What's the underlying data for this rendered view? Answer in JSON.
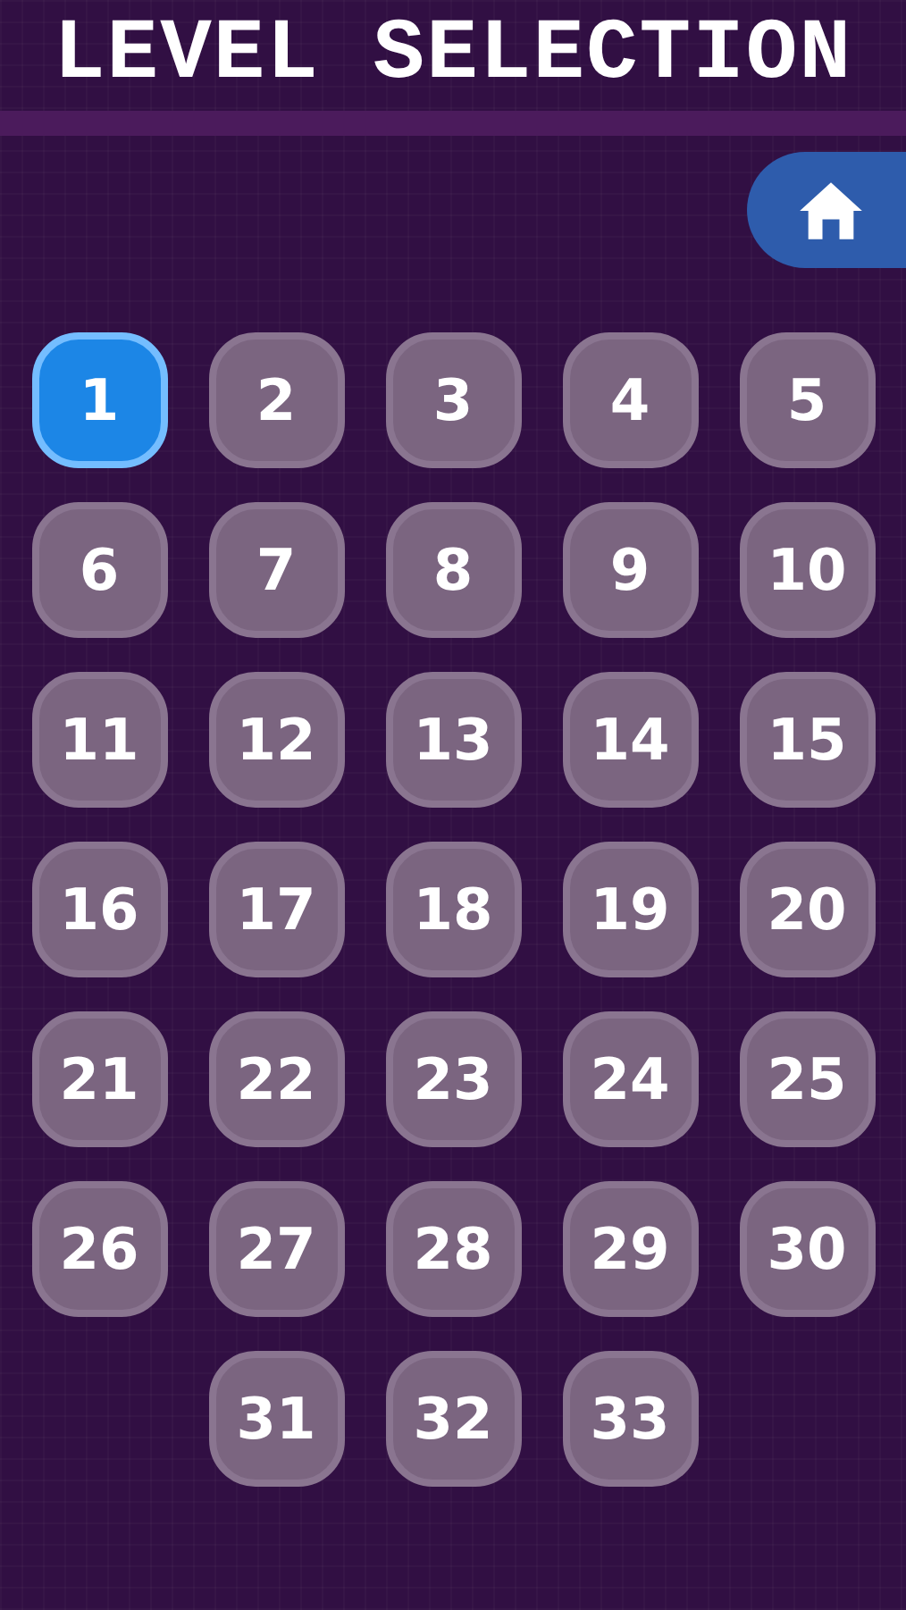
{
  "title": "LEVEL SELECTION",
  "levels": [
    {
      "label": "1",
      "selected": true
    },
    {
      "label": "2",
      "selected": false
    },
    {
      "label": "3",
      "selected": false
    },
    {
      "label": "4",
      "selected": false
    },
    {
      "label": "5",
      "selected": false
    },
    {
      "label": "6",
      "selected": false
    },
    {
      "label": "7",
      "selected": false
    },
    {
      "label": "8",
      "selected": false
    },
    {
      "label": "9",
      "selected": false
    },
    {
      "label": "10",
      "selected": false
    },
    {
      "label": "11",
      "selected": false
    },
    {
      "label": "12",
      "selected": false
    },
    {
      "label": "13",
      "selected": false
    },
    {
      "label": "14",
      "selected": false
    },
    {
      "label": "15",
      "selected": false
    },
    {
      "label": "16",
      "selected": false
    },
    {
      "label": "17",
      "selected": false
    },
    {
      "label": "18",
      "selected": false
    },
    {
      "label": "19",
      "selected": false
    },
    {
      "label": "20",
      "selected": false
    },
    {
      "label": "21",
      "selected": false
    },
    {
      "label": "22",
      "selected": false
    },
    {
      "label": "23",
      "selected": false
    },
    {
      "label": "24",
      "selected": false
    },
    {
      "label": "25",
      "selected": false
    },
    {
      "label": "26",
      "selected": false
    },
    {
      "label": "27",
      "selected": false
    },
    {
      "label": "28",
      "selected": false
    },
    {
      "label": "29",
      "selected": false
    },
    {
      "label": "30",
      "selected": false
    },
    {
      "label": "31",
      "selected": false
    },
    {
      "label": "32",
      "selected": false
    },
    {
      "label": "33",
      "selected": false
    }
  ]
}
